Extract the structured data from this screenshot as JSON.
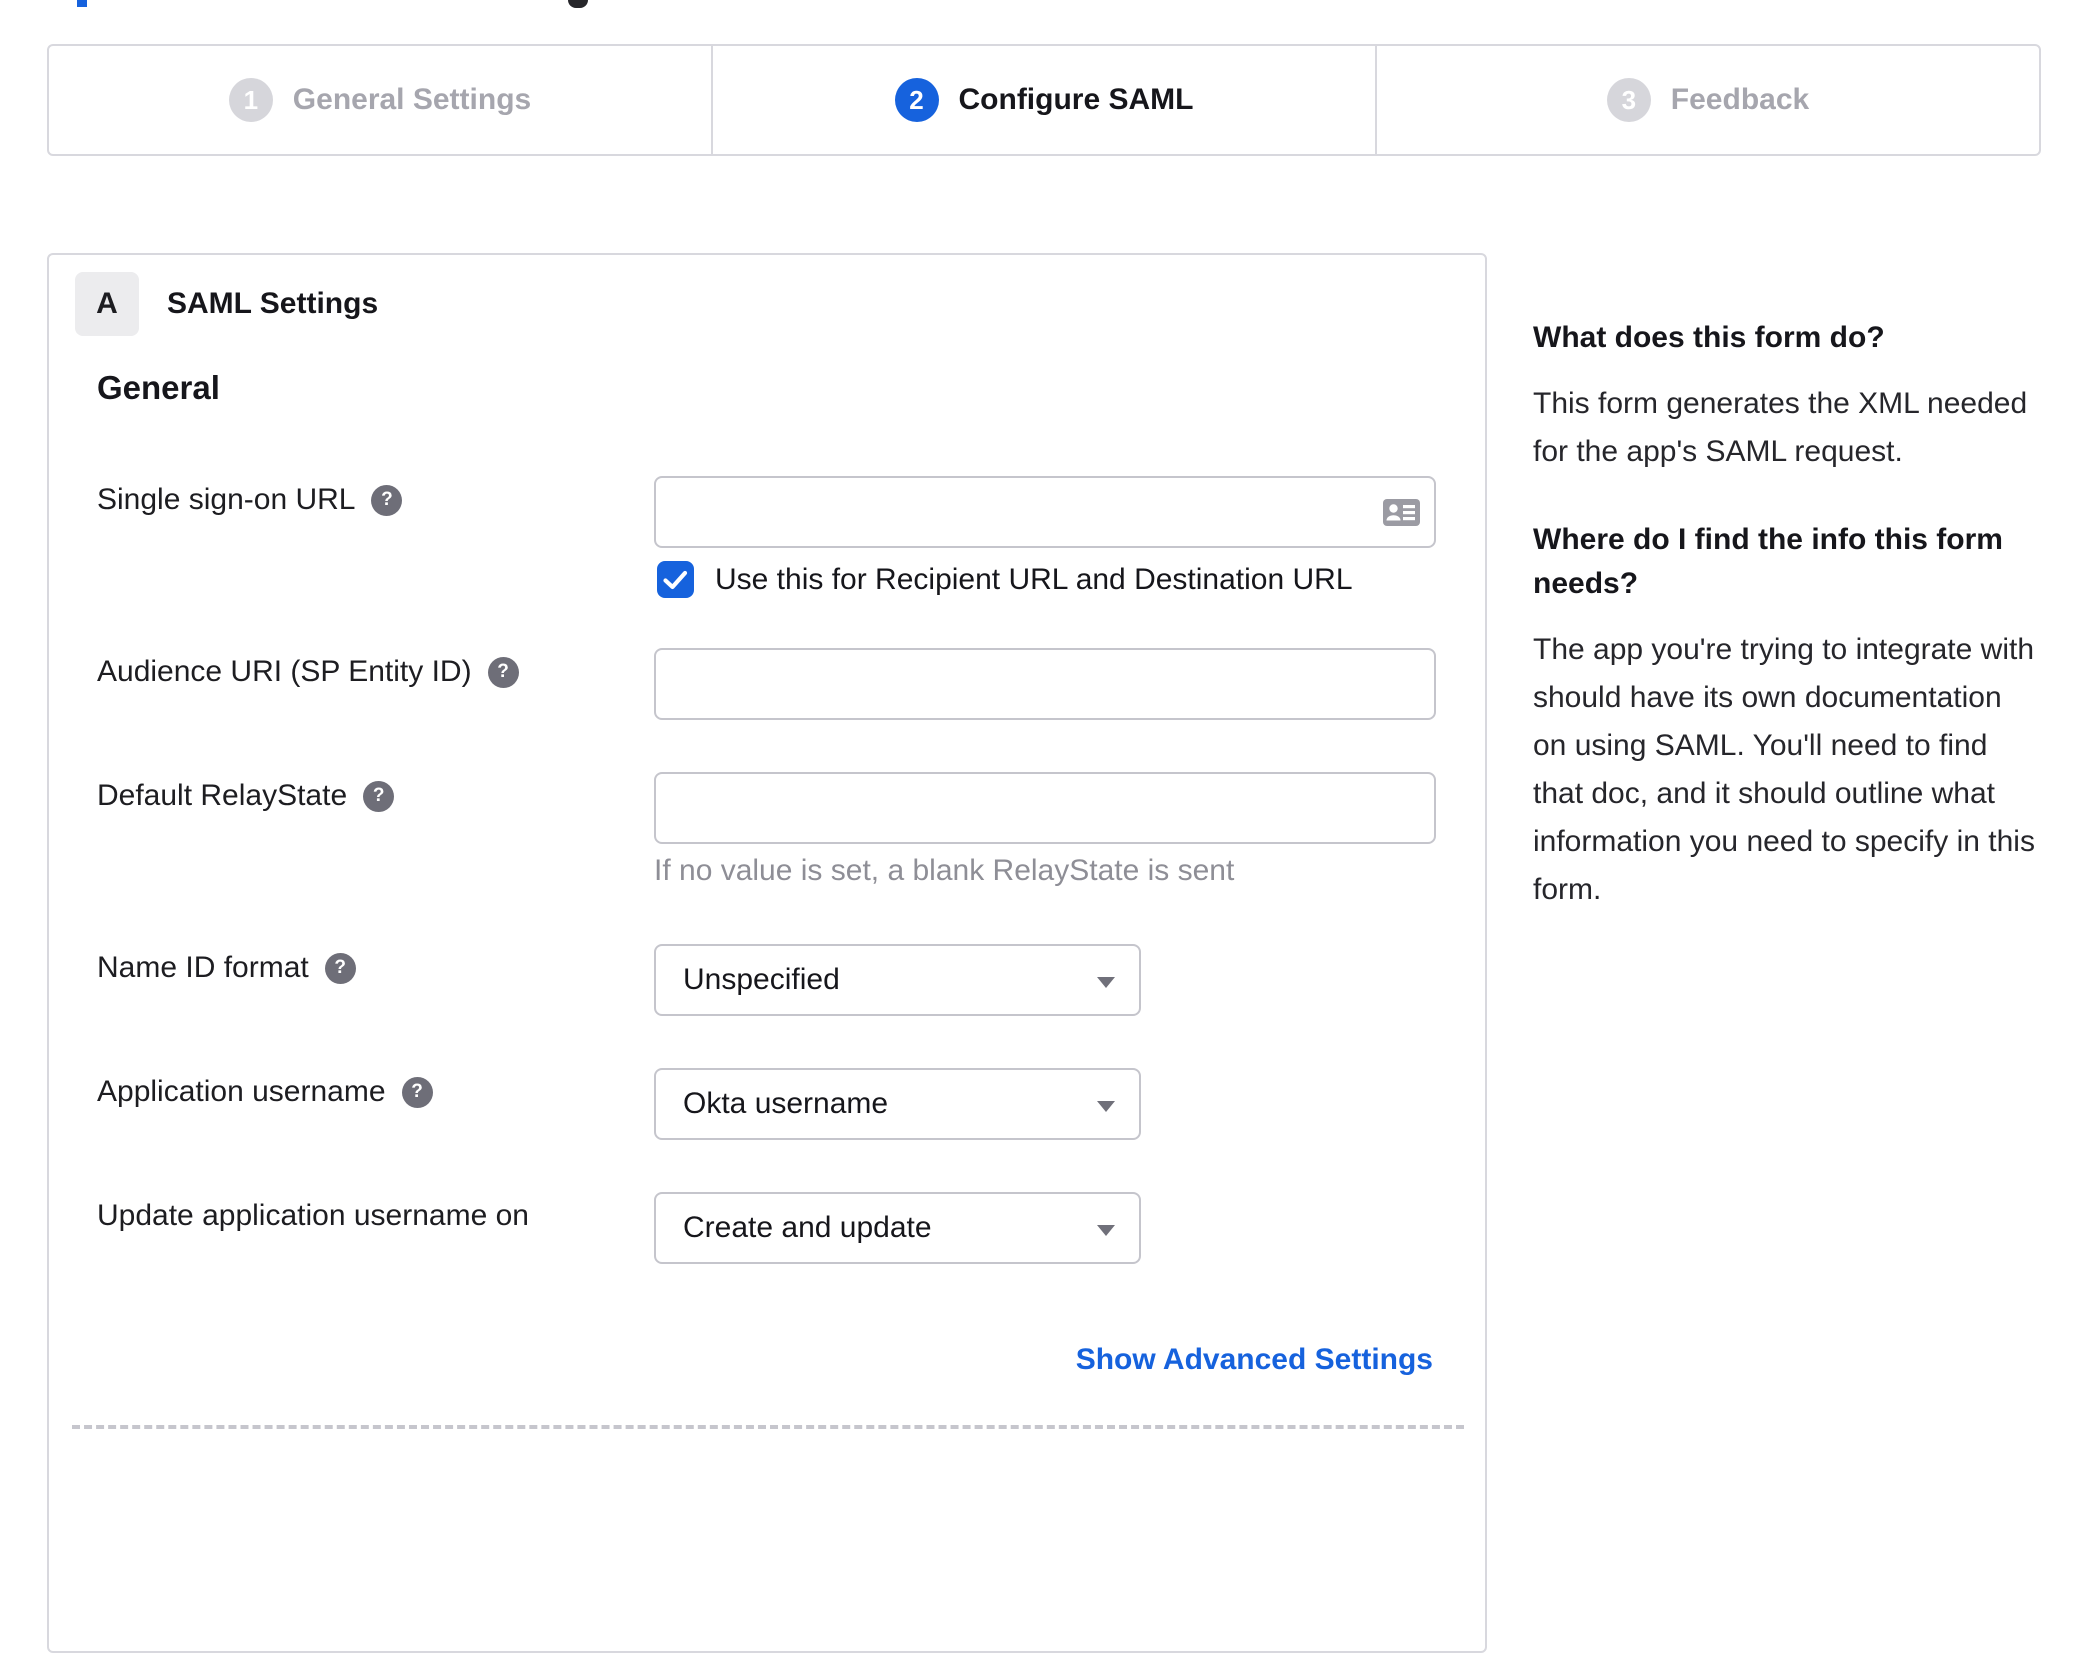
{
  "accent_blue": "#1662dd",
  "stepper": {
    "steps": [
      {
        "number": "1",
        "label": "General Settings",
        "state": "inactive"
      },
      {
        "number": "2",
        "label": "Configure SAML",
        "state": "active"
      },
      {
        "number": "3",
        "label": "Feedback",
        "state": "inactive"
      }
    ]
  },
  "panel": {
    "section_badge": "A",
    "section_title": "SAML Settings",
    "group_heading": "General",
    "fields": {
      "sso_url": {
        "label": "Single sign-on URL",
        "value": "",
        "checkbox_label": "Use this for Recipient URL and Destination URL",
        "checked": true
      },
      "audience_uri": {
        "label": "Audience URI (SP Entity ID)",
        "value": ""
      },
      "default_relaystate": {
        "label": "Default RelayState",
        "value": "",
        "hint": "If no value is set, a blank RelayState is sent"
      },
      "name_id_format": {
        "label": "Name ID format",
        "value": "Unspecified"
      },
      "application_username": {
        "label": "Application username",
        "value": "Okta username"
      },
      "update_app_username": {
        "label": "Update application username on",
        "value": "Create and update"
      }
    },
    "advanced_link": "Show Advanced Settings"
  },
  "sidebar": {
    "sections": [
      {
        "heading": "What does this form do?",
        "body": "This form generates the XML needed for the app's SAML request."
      },
      {
        "heading": "Where do I find the info this form needs?",
        "body": "The app you're trying to integrate with should have its own documentation on using SAML. You'll need to find that doc, and it should outline what information you need to specify in this form."
      }
    ]
  }
}
